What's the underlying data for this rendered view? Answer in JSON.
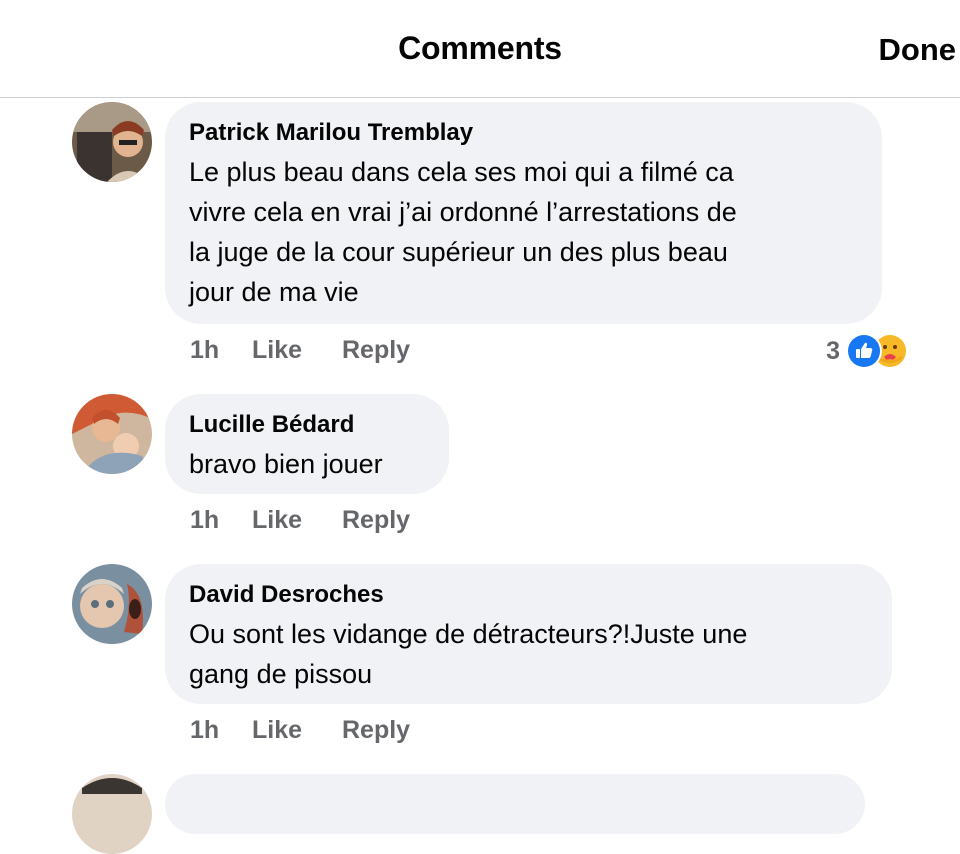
{
  "header": {
    "title": "Comments",
    "done_label": "Done"
  },
  "comments": [
    {
      "author": "Patrick Marilou Tremblay",
      "text_lines": [
        "Le plus beau dans cela ses moi qui a filmé ca",
        "vivre cela en vrai j’ai ordonné l’arrestations de",
        "la juge de la cour supérieur un des plus beau",
        "jour de ma vie"
      ],
      "time": "1h",
      "like_label": "Like",
      "reply_label": "Reply",
      "reaction_count": "3",
      "reaction_icons": [
        "like-icon",
        "care-icon"
      ]
    },
    {
      "author": "Lucille Bédard",
      "text_lines": [
        "bravo bien jouer"
      ],
      "time": "1h",
      "like_label": "Like",
      "reply_label": "Reply"
    },
    {
      "author": "David Desroches",
      "text_lines": [
        "Ou sont les vidange de détracteurs?!Juste une",
        "gang de pissou"
      ],
      "time": "1h",
      "like_label": "Like",
      "reply_label": "Reply"
    }
  ],
  "colors": {
    "like_blue": "#1877f2",
    "care_yellow": "#f7b928",
    "bubble": "#f0f2f5",
    "meta_gray": "#65676b"
  }
}
